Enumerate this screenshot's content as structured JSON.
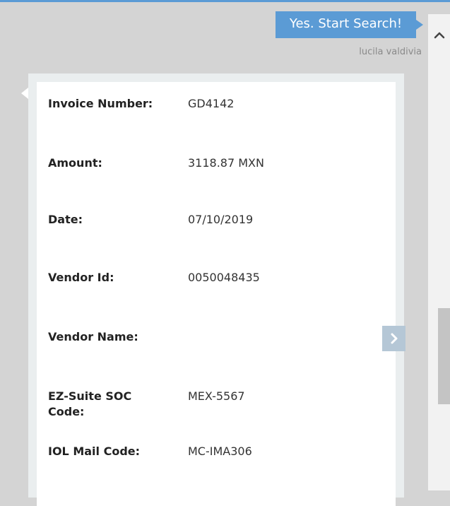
{
  "chat": {
    "user_message": "Yes. Start Search!",
    "sender_name": "lucila valdivia"
  },
  "invoice_card": {
    "fields": [
      {
        "label": "Invoice Number:",
        "value": "GD4142"
      },
      {
        "label": "Amount:",
        "value": "3118.87 MXN"
      },
      {
        "label": "Date:",
        "value": "07/10/2019"
      },
      {
        "label": "Vendor Id:",
        "value": "0050048435"
      },
      {
        "label": "Vendor Name:",
        "value": ""
      },
      {
        "label": "EZ-Suite SOC Code:",
        "value": "MEX-5567"
      },
      {
        "label": "IOL Mail Code:",
        "value": "MC-IMA306"
      }
    ]
  },
  "icons": {
    "next": "chevron-right-icon",
    "scroll_up": "chevron-up-icon"
  },
  "colors": {
    "accent": "#5b9bd5",
    "next_button": "#b5c7d6",
    "background": "#d4d4d4"
  }
}
